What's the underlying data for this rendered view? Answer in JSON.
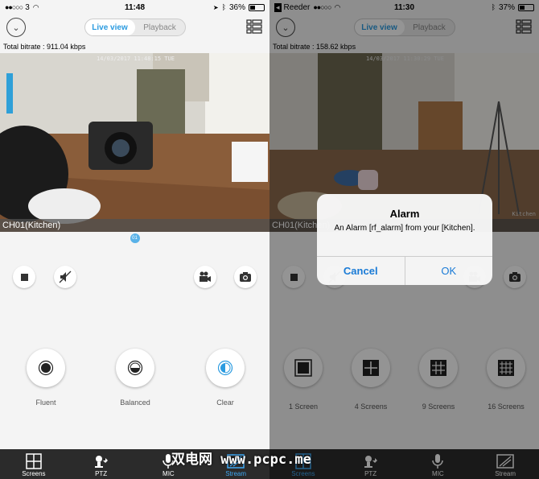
{
  "left": {
    "status": {
      "carrier": "3",
      "time": "11:48",
      "battery": "36%"
    },
    "tabs": {
      "live": "Live view",
      "playback": "Playback"
    },
    "bitrate": "Total bitrate :  911.04 kbps",
    "video": {
      "timestamp": "14/03/2017 11:48:15 TUE",
      "channel": "CH01(Kitchen)",
      "page": "01"
    },
    "modes": [
      {
        "label": "Fluent"
      },
      {
        "label": "Balanced"
      },
      {
        "label": "Clear"
      }
    ],
    "tabbar": [
      {
        "label": "Screens",
        "icon": "screens-icon"
      },
      {
        "label": "PTZ",
        "icon": "ptz-icon"
      },
      {
        "label": "MIC",
        "icon": "mic-icon"
      },
      {
        "label": "Stream",
        "icon": "stream-icon"
      }
    ]
  },
  "right": {
    "status": {
      "back": "Reeder",
      "time": "11:30",
      "battery": "37%"
    },
    "tabs": {
      "live": "Live view",
      "playback": "Playback"
    },
    "bitrate": "Total bitrate :  158.62 kbps",
    "video": {
      "timestamp": "14/03/2017 11:30:29 TUE",
      "channel": "CH01(Kitchen)",
      "watermark": "Kitchen"
    },
    "screens": [
      {
        "label": "1 Screen"
      },
      {
        "label": "4 Screens"
      },
      {
        "label": "9 Screens"
      },
      {
        "label": "16 Screens"
      }
    ],
    "tabbar": [
      {
        "label": "Screens",
        "icon": "screens-icon"
      },
      {
        "label": "PTZ",
        "icon": "ptz-icon"
      },
      {
        "label": "MIC",
        "icon": "mic-icon"
      },
      {
        "label": "Stream",
        "icon": "stream-icon"
      }
    ],
    "alert": {
      "title": "Alarm",
      "message": "An Alarm [rf_alarm] from your [Kitchen].",
      "cancel": "Cancel",
      "ok": "OK"
    }
  },
  "watermark": "双电网 www.pcpc.me",
  "colors": {
    "accent": "#2b9be0",
    "tabbar": "#2b2b2b",
    "alert_button": "#1a7bd6"
  }
}
